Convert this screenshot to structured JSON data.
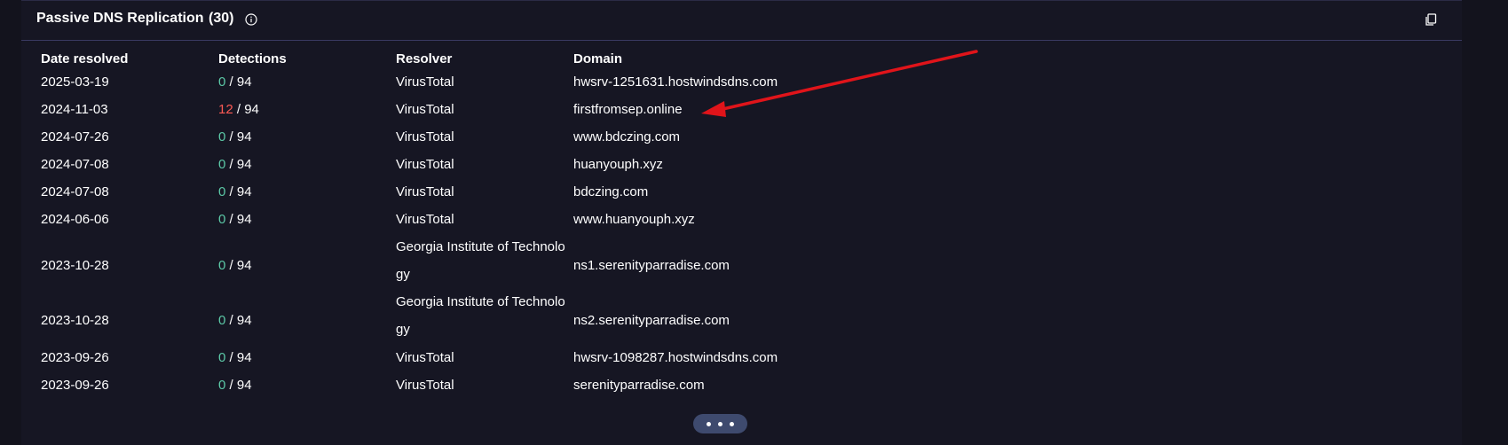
{
  "header": {
    "title": "Passive DNS Replication",
    "count": "(30)"
  },
  "table": {
    "columns": [
      "Date resolved",
      "Detections",
      "Resolver",
      "Domain"
    ],
    "rows": [
      {
        "date": "2025-03-19",
        "detections": "0",
        "total": " / 94",
        "resolver": "VirusTotal",
        "domain": "hwsrv-1251631.hostwindsdns.com"
      },
      {
        "date": "2024-11-03",
        "detections": "12",
        "total": " / 94",
        "resolver": "VirusTotal",
        "domain": "firstfromsep.online"
      },
      {
        "date": "2024-07-26",
        "detections": "0",
        "total": " / 94",
        "resolver": "VirusTotal",
        "domain": "www.bdczing.com"
      },
      {
        "date": "2024-07-08",
        "detections": "0",
        "total": " / 94",
        "resolver": "VirusTotal",
        "domain": "huanyouph.xyz"
      },
      {
        "date": "2024-07-08",
        "detections": "0",
        "total": " / 94",
        "resolver": "VirusTotal",
        "domain": "bdczing.com"
      },
      {
        "date": "2024-06-06",
        "detections": "0",
        "total": " / 94",
        "resolver": "VirusTotal",
        "domain": "www.huanyouph.xyz"
      },
      {
        "date": "2023-10-28",
        "detections": "0",
        "total": " / 94",
        "resolver": "Georgia Institute of Technology",
        "domain": "ns1.serenityparradise.com"
      },
      {
        "date": "2023-10-28",
        "detections": "0",
        "total": " / 94",
        "resolver": "Georgia Institute of Technology",
        "domain": "ns2.serenityparradise.com"
      },
      {
        "date": "2023-09-26",
        "detections": "0",
        "total": " / 94",
        "resolver": "VirusTotal",
        "domain": "hwsrv-1098287.hostwindsdns.com"
      },
      {
        "date": "2023-09-26",
        "detections": "0",
        "total": " / 94",
        "resolver": "VirusTotal",
        "domain": "serenityparradise.com"
      }
    ]
  },
  "icons": {
    "info": "info-icon",
    "copy": "copy-icon",
    "more": "ellipsis-icon"
  },
  "colors": {
    "background": "#13131d",
    "detections_zero": "#5cc9a7",
    "detections_positive": "#ff5a55",
    "arrow": "#e0141a",
    "more_button": "#3e4a6e"
  }
}
